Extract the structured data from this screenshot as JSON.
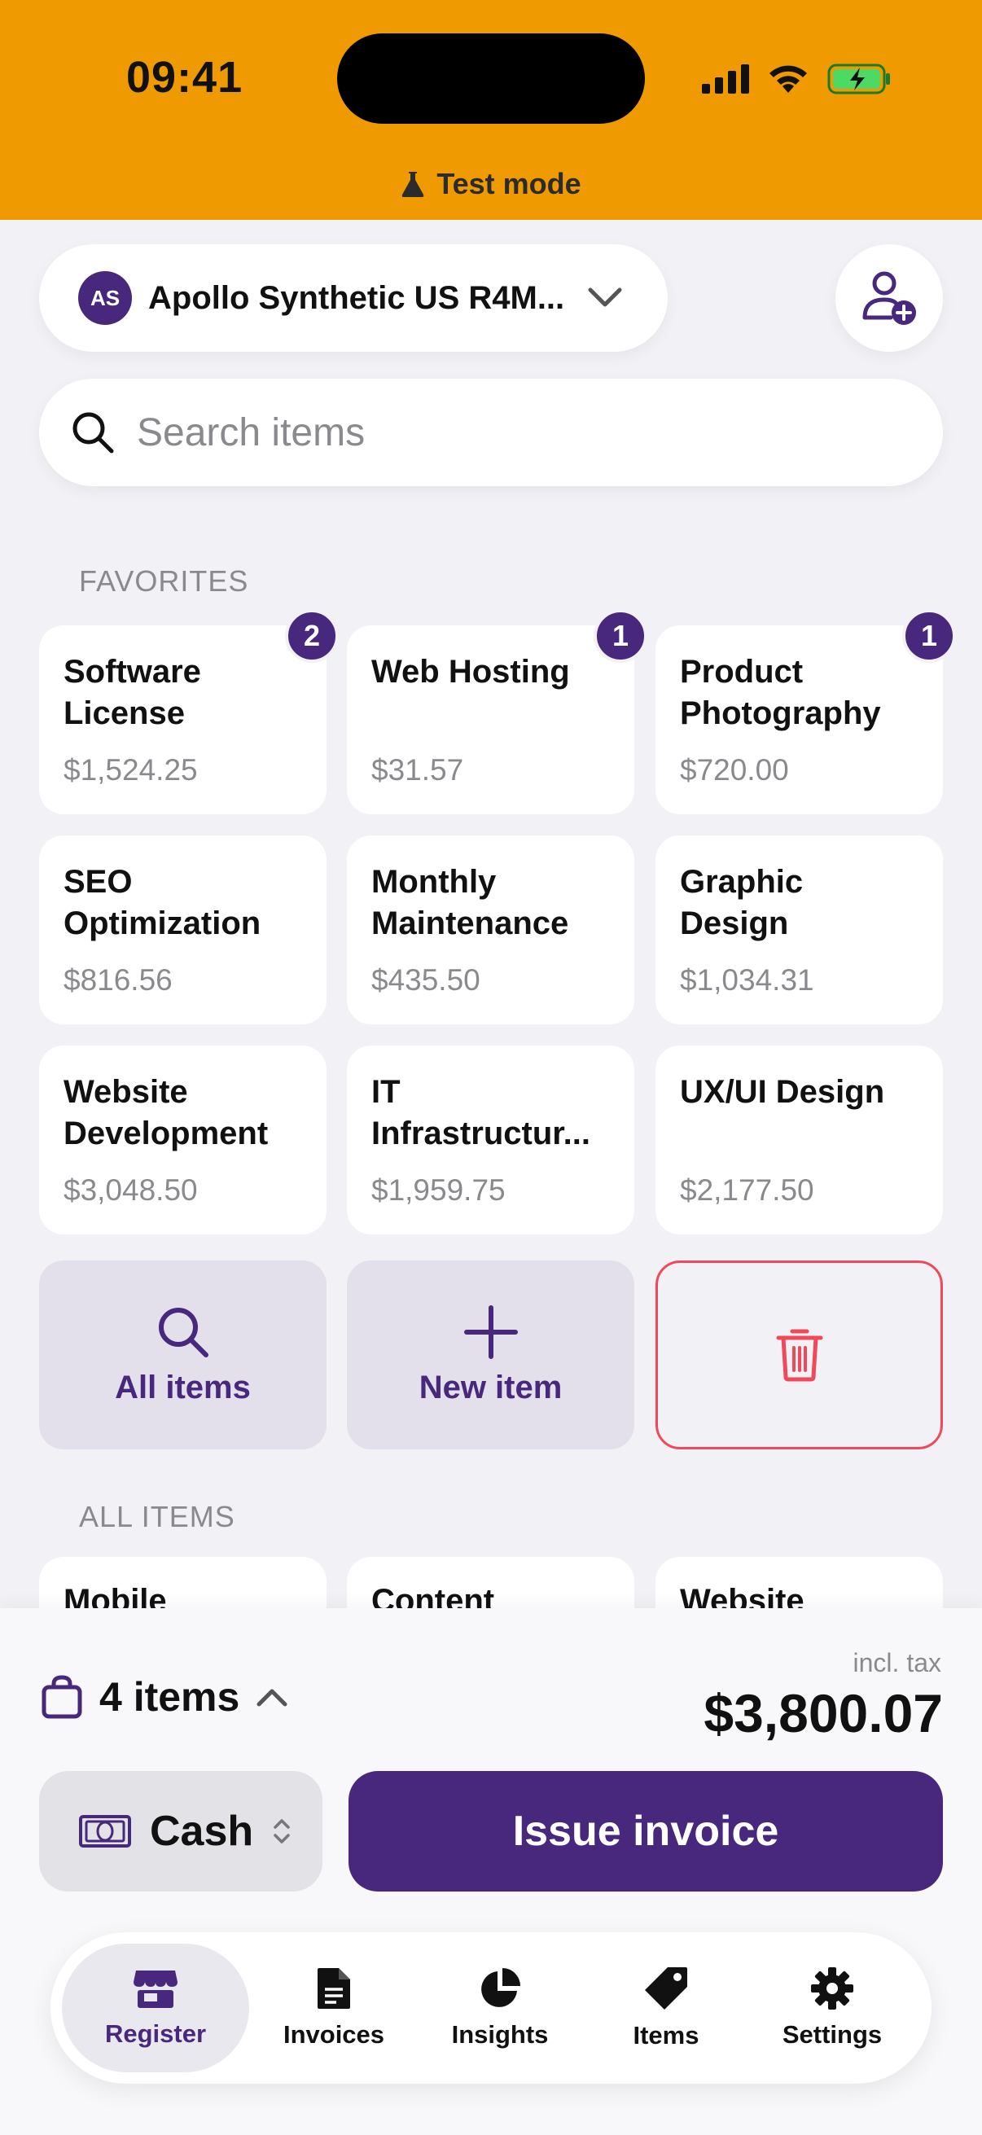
{
  "status_bar": {
    "time": "09:41"
  },
  "test_mode_label": "Test mode",
  "account": {
    "initials": "AS",
    "name": "Apollo Synthetic US R4M..."
  },
  "search": {
    "placeholder": "Search items"
  },
  "favorites": {
    "section_label": "FAVORITES",
    "items": [
      {
        "name": "Software License",
        "price": "$1,524.25",
        "badge": "2"
      },
      {
        "name": "Web Hosting",
        "price": "$31.57",
        "badge": "1"
      },
      {
        "name": "Product Photography",
        "price": "$720.00",
        "badge": "1"
      },
      {
        "name": "SEO Optimization",
        "price": "$816.56",
        "badge": ""
      },
      {
        "name": "Monthly Maintenance",
        "price": "$435.50",
        "badge": ""
      },
      {
        "name": "Graphic Design",
        "price": "$1,034.31",
        "badge": ""
      },
      {
        "name": "Website Development",
        "price": "$3,048.50",
        "badge": ""
      },
      {
        "name": "IT Infrastructur...",
        "price": "$1,959.75",
        "badge": ""
      },
      {
        "name": "UX/UI Design",
        "price": "$2,177.50",
        "badge": ""
      }
    ],
    "actions": {
      "all_items": "All items",
      "new_item": "New item"
    }
  },
  "all_items": {
    "section_label": "ALL ITEMS",
    "peek": [
      "Mobile",
      "Content",
      "Website"
    ]
  },
  "cart": {
    "count_label": "4 items",
    "incl_tax": "incl. tax",
    "total": "$3,800.07",
    "payment_method": "Cash",
    "issue_button": "Issue invoice"
  },
  "tabs": [
    {
      "label": "Register",
      "icon": "store-icon",
      "active": true
    },
    {
      "label": "Invoices",
      "icon": "document-icon",
      "active": false
    },
    {
      "label": "Insights",
      "icon": "pie-chart-icon",
      "active": false
    },
    {
      "label": "Items",
      "icon": "tag-icon",
      "active": false
    },
    {
      "label": "Settings",
      "icon": "gear-icon",
      "active": false
    }
  ],
  "colors": {
    "accent": "#47287c",
    "test_mode_band": "#ef9a00",
    "danger": "#f04a5a",
    "background": "#f2f1f6"
  }
}
